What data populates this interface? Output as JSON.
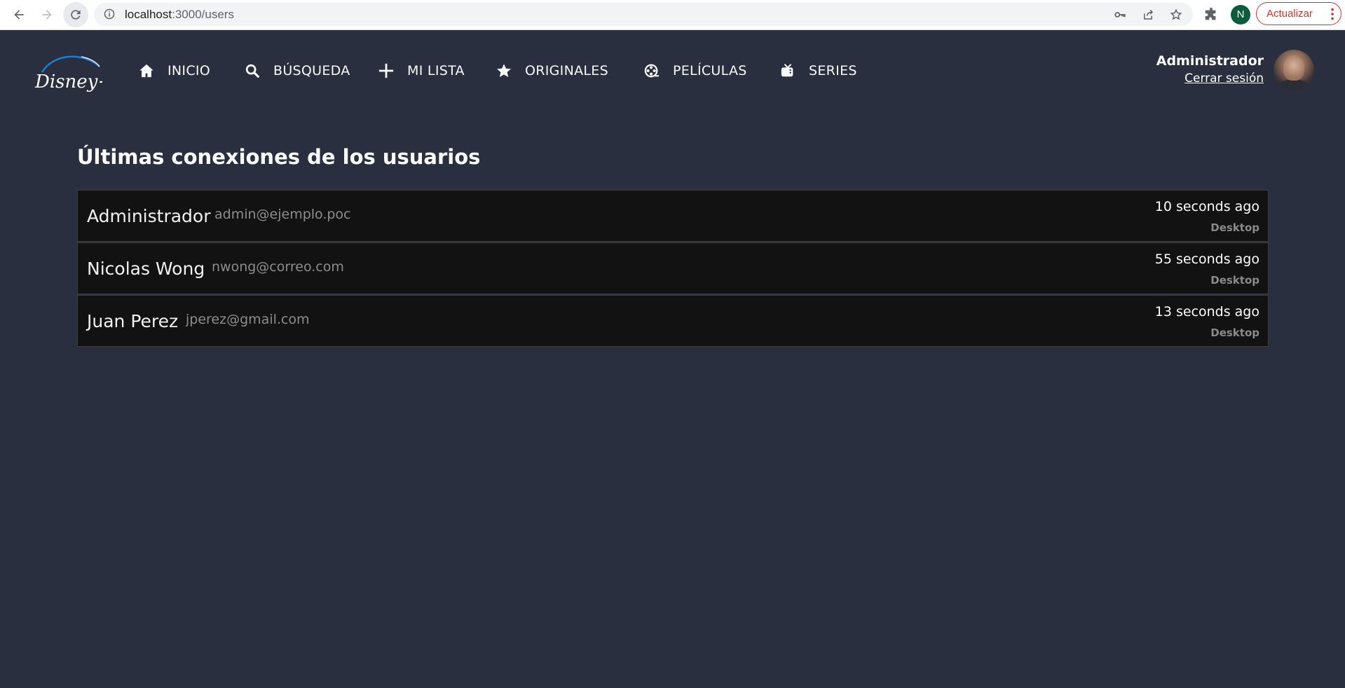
{
  "browser": {
    "url_host": "localhost",
    "url_path": ":3000/users",
    "profile_initial": "N",
    "update_label": "Actualizar",
    "accent_color": "#d93025"
  },
  "header": {
    "logo_text": "Disney+",
    "nav": [
      {
        "label": "INICIO",
        "icon": "home-icon"
      },
      {
        "label": "BÚSQUEDA",
        "icon": "search-icon"
      },
      {
        "label": "MI LISTA",
        "icon": "plus-icon"
      },
      {
        "label": "ORIGINALES",
        "icon": "star-icon"
      },
      {
        "label": "PELÍCULAS",
        "icon": "film-reel-icon"
      },
      {
        "label": "SERIES",
        "icon": "tv-icon"
      }
    ],
    "user": {
      "name": "Administrador",
      "logout_label": "Cerrar sesión"
    }
  },
  "main": {
    "title": "Últimas conexiones de los usuarios",
    "users": [
      {
        "name": "Administrador",
        "email": "admin@ejemplo.poc",
        "last_seen": "10 seconds ago",
        "device": "Desktop"
      },
      {
        "name": "Nicolas Wong",
        "email": "nwong@correo.com",
        "last_seen": "55 seconds ago",
        "device": "Desktop"
      },
      {
        "name": "Juan Perez",
        "email": "jperez@gmail.com",
        "last_seen": "13 seconds ago",
        "device": "Desktop"
      }
    ]
  },
  "colors": {
    "background": "#2a2f40",
    "row_background": "#121212"
  }
}
